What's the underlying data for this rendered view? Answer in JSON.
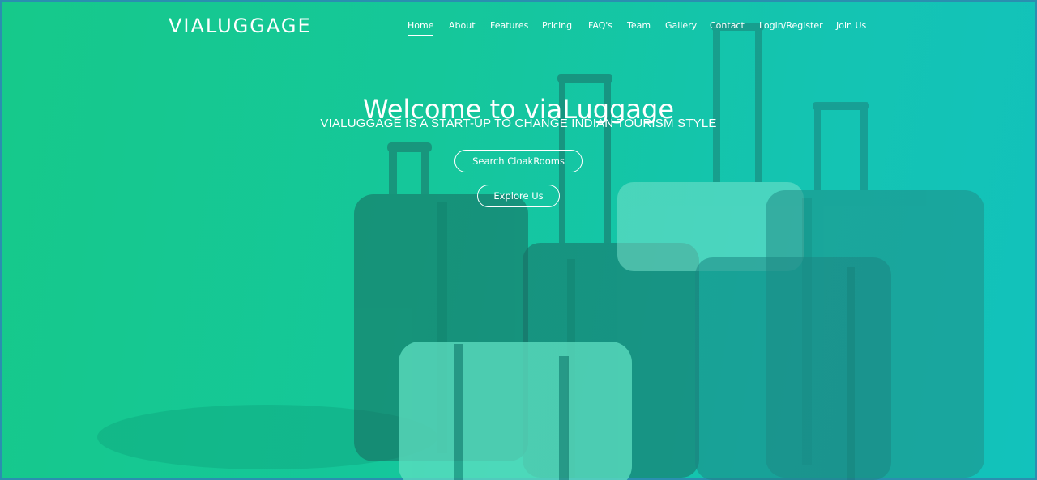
{
  "brand": "VIALUGGAGE",
  "nav": {
    "home": "Home",
    "about": "About",
    "features": "Features",
    "pricing": "Pricing",
    "faqs": "FAQ's",
    "team": "Team",
    "gallery": "Gallery",
    "contact": "Contact",
    "login": "Login/Register",
    "join": "Join Us"
  },
  "hero": {
    "title": "Welcome to viaLuggage",
    "subtitle": "VIALUGGAGE IS A START-UP TO CHANGE INDIAN TOURISM STYLE",
    "search_button": "Search CloakRooms",
    "explore_button": "Explore Us"
  },
  "colors": {
    "gradient_start": "#16c98a",
    "gradient_end": "#12c2bc",
    "text": "#ffffff"
  }
}
